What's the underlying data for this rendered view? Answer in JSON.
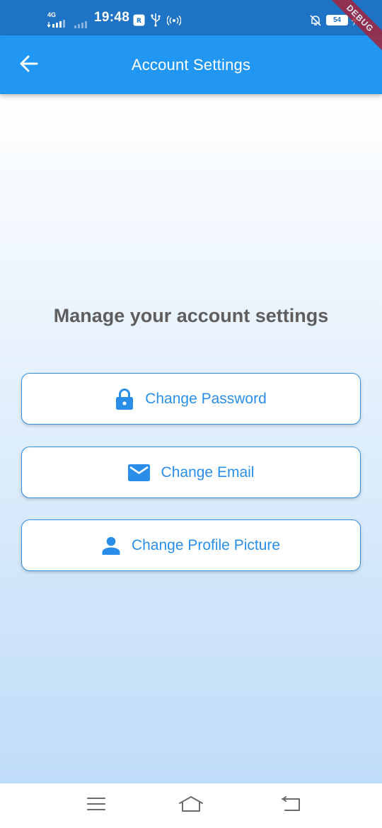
{
  "status_bar": {
    "network": "4G",
    "time": "19:48",
    "battery": "54",
    "debug_banner": "DEBUG",
    "icons": [
      "signal-bars-icon",
      "signal-bars-weak-icon",
      "app-notification-icon",
      "usb-icon",
      "hotspot-icon",
      "notifications-off-icon",
      "battery-icon",
      "charging-icon"
    ]
  },
  "app_bar": {
    "title": "Account Settings",
    "back_icon": "arrow-left-icon",
    "color": "#2196f3"
  },
  "main": {
    "heading": "Manage your account settings",
    "options": [
      {
        "label": "Change Password",
        "icon": "lock-icon"
      },
      {
        "label": "Change Email",
        "icon": "mail-icon"
      },
      {
        "label": "Change Profile Picture",
        "icon": "person-icon"
      }
    ],
    "accent_color": "#2a8ee8",
    "gradient": [
      "#ffffff",
      "#bfdcf8"
    ]
  },
  "nav_bar": {
    "keys": [
      "menu-icon",
      "home-icon",
      "back-icon"
    ]
  }
}
